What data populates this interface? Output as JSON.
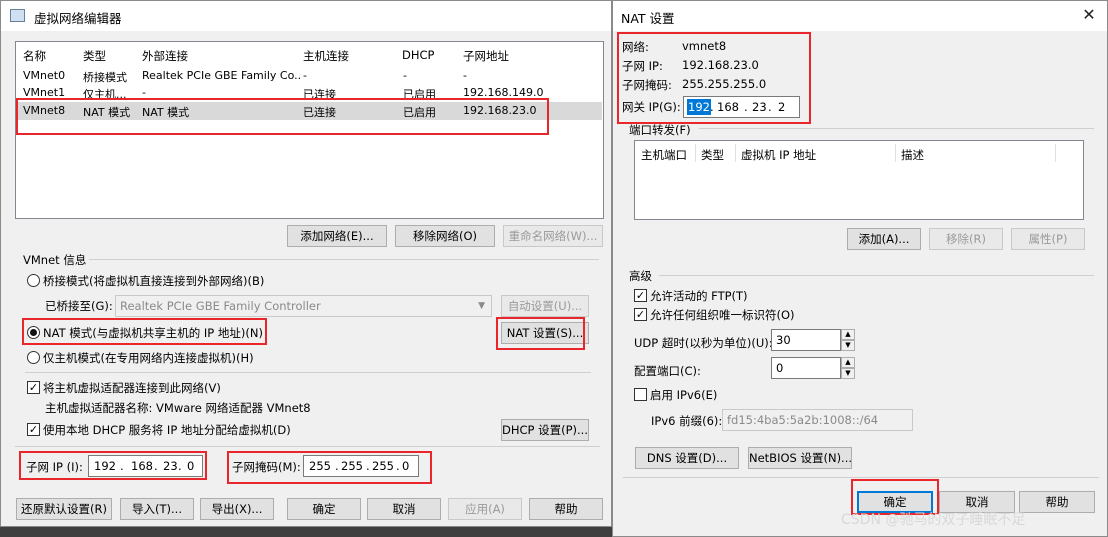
{
  "vne": {
    "title": "虚拟网络编辑器",
    "columns": [
      "名称",
      "类型",
      "外部连接",
      "主机连接",
      "DHCP",
      "子网地址"
    ],
    "rows": [
      {
        "name": "VMnet0",
        "type": "桥接模式",
        "ext": "Realtek PCIe GBE Family Co...",
        "host": "-",
        "dhcp": "-",
        "subnet": "-"
      },
      {
        "name": "VMnet1",
        "type": "仅主机...",
        "ext": "-",
        "host": "已连接",
        "dhcp": "已启用",
        "subnet": "192.168.149.0"
      },
      {
        "name": "VMnet8",
        "type": "NAT 模式",
        "ext": "NAT 模式",
        "host": "已连接",
        "dhcp": "已启用",
        "subnet": "192.168.23.0"
      }
    ],
    "add_network": "添加网络(E)...",
    "remove_network": "移除网络(O)",
    "rename_network": "重命名网络(W)...",
    "vmnet_info": "VMnet 信息",
    "bridge_mode": "桥接模式(将虚拟机直接连接到外部网络)(B)",
    "bridged_to_label": "已桥接至(G):",
    "bridged_to_value": "Realtek PCIe GBE Family Controller",
    "auto_settings": "自动设置(U)...",
    "nat_mode": "NAT 模式(与虚拟机共享主机的 IP 地址)(N)",
    "nat_settings": "NAT 设置(S)...",
    "host_only": "仅主机模式(在专用网络内连接虚拟机)(H)",
    "connect_adapter": "将主机虚拟适配器连接到此网络(V)",
    "adapter_name": "主机虚拟适配器名称: VMware 网络适配器 VMnet8",
    "use_dhcp": "使用本地 DHCP 服务将 IP 地址分配给虚拟机(D)",
    "dhcp_settings": "DHCP 设置(P)...",
    "subnet_ip_label": "子网 IP (I):",
    "subnet_ip": [
      "192",
      "168",
      "23",
      "0"
    ],
    "subnet_mask_label": "子网掩码(M):",
    "subnet_mask": [
      "255",
      "255",
      "255",
      "0"
    ],
    "restore": "还原默认设置(R)",
    "import": "导入(T)...",
    "export": "导出(X)...",
    "ok": "确定",
    "cancel": "取消",
    "apply": "应用(A)",
    "help": "帮助"
  },
  "nat": {
    "title": "NAT 设置",
    "network_label": "网络:",
    "network_value": "vmnet8",
    "subnet_ip_label": "子网 IP:",
    "subnet_ip_value": "192.168.23.0",
    "subnet_mask_label": "子网掩码:",
    "subnet_mask_value": "255.255.255.0",
    "gateway_label": "网关 IP(G):",
    "gateway": [
      "192",
      "168",
      "23",
      "2"
    ],
    "port_forward": "端口转发(F)",
    "pf_columns": [
      "主机端口",
      "类型",
      "虚拟机 IP 地址",
      "描述"
    ],
    "add": "添加(A)...",
    "remove": "移除(R)",
    "properties": "属性(P)",
    "advanced": "高级",
    "allow_ftp": "允许活动的 FTP(T)",
    "allow_any_oui": "允许任何组织唯一标识符(O)",
    "udp_timeout_label": "UDP 超时(以秒为单位)(U):",
    "udp_timeout": "30",
    "config_port_label": "配置端口(C):",
    "config_port": "0",
    "enable_ipv6": "启用 IPv6(E)",
    "ipv6_prefix_label": "IPv6 前缀(6):",
    "ipv6_prefix": "fd15:4ba5:5a2b:1008::/64",
    "dns": "DNS 设置(D)...",
    "netbios": "NetBIOS 设置(N)...",
    "ok": "确定",
    "cancel": "取消",
    "help": "帮助"
  },
  "watermark": "CSDN @驰马的双子睡眠不足"
}
